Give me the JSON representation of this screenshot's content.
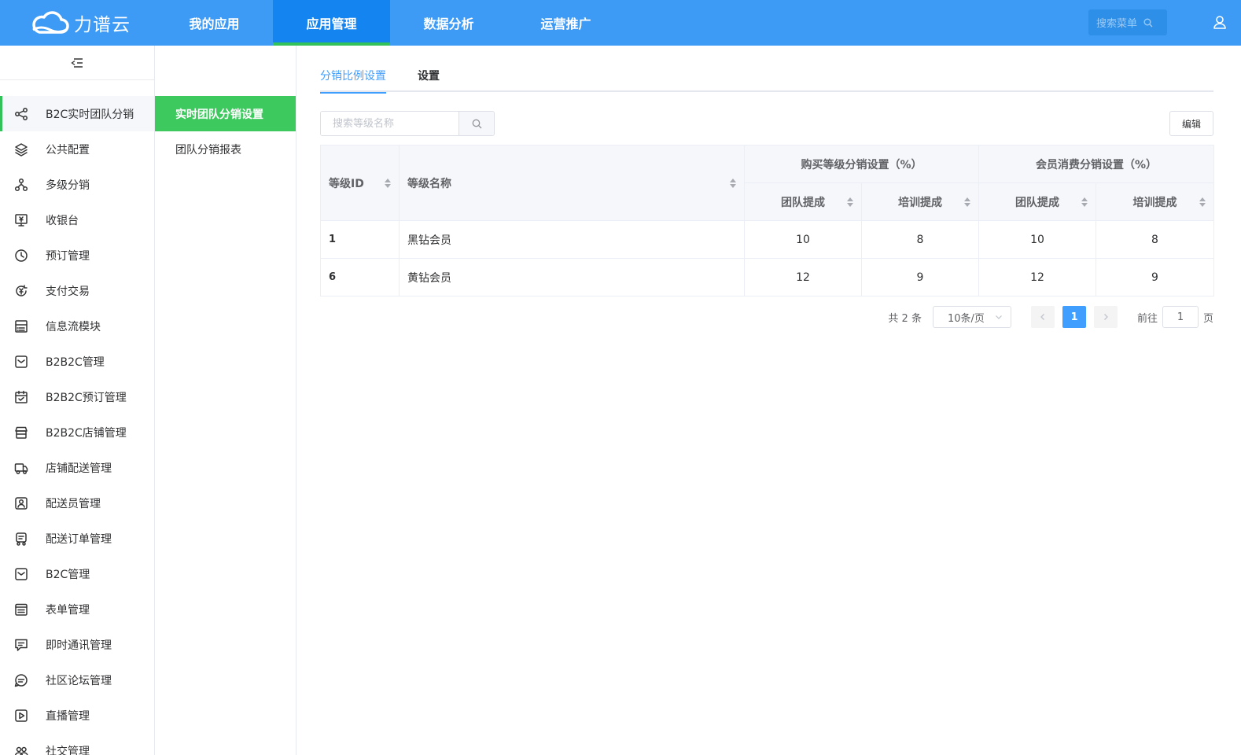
{
  "header": {
    "logo_text": "力谱云",
    "nav": [
      "我的应用",
      "应用管理",
      "数据分析",
      "运营推广"
    ],
    "active_nav": 1,
    "menu_search_placeholder": "搜索菜单"
  },
  "sidebar": {
    "items": [
      {
        "label": "B2C实时团队分销",
        "icon": "share-icon"
      },
      {
        "label": "公共配置",
        "icon": "layers-icon"
      },
      {
        "label": "多级分销",
        "icon": "hierarchy-icon"
      },
      {
        "label": "收银台",
        "icon": "cashier-icon"
      },
      {
        "label": "预订管理",
        "icon": "clock-icon"
      },
      {
        "label": "支付交易",
        "icon": "payment-icon"
      },
      {
        "label": "信息流模块",
        "icon": "feed-icon"
      },
      {
        "label": "B2B2C管理",
        "icon": "box-icon"
      },
      {
        "label": "B2B2C预订管理",
        "icon": "calendar-check-icon"
      },
      {
        "label": "B2B2C店铺管理",
        "icon": "store-icon"
      },
      {
        "label": "店铺配送管理",
        "icon": "truck-icon"
      },
      {
        "label": "配送员管理",
        "icon": "courier-icon"
      },
      {
        "label": "配送订单管理",
        "icon": "delivery-order-icon"
      },
      {
        "label": "B2C管理",
        "icon": "box-icon"
      },
      {
        "label": "表单管理",
        "icon": "form-icon"
      },
      {
        "label": "即时通讯管理",
        "icon": "chat-icon"
      },
      {
        "label": "社区论坛管理",
        "icon": "forum-icon"
      },
      {
        "label": "直播管理",
        "icon": "play-icon"
      },
      {
        "label": "社交管理",
        "icon": "social-icon"
      }
    ]
  },
  "submenu": {
    "items": [
      "实时团队分销设置",
      "团队分销报表"
    ]
  },
  "tabs": [
    "分销比例设置",
    "设置"
  ],
  "toolbar": {
    "search_placeholder": "搜索等级名称",
    "edit_label": "编辑"
  },
  "table": {
    "col_id": "等级ID",
    "col_name": "等级名称",
    "group_buy": "购买等级分销设置（%）",
    "group_consume": "会员消费分销设置（%）",
    "sub_team": "团队提成",
    "sub_train": "培训提成",
    "rows": [
      {
        "id": "1",
        "name": "黑钻会员",
        "buy_team": "10",
        "buy_train": "8",
        "consume_team": "10",
        "consume_train": "8"
      },
      {
        "id": "6",
        "name": "黄钻会员",
        "buy_team": "12",
        "buy_train": "9",
        "consume_team": "12",
        "consume_train": "9"
      }
    ]
  },
  "pager": {
    "total": "共 2 条",
    "page_size": "10条/页",
    "current": "1",
    "goto_label": "前往",
    "goto_value": "1",
    "page_suffix": "页"
  },
  "colors": {
    "topbar": "#3d9bf5",
    "nav_active": "#1485f0",
    "accent_green": "#3ec95e",
    "primary": "#409eff"
  }
}
